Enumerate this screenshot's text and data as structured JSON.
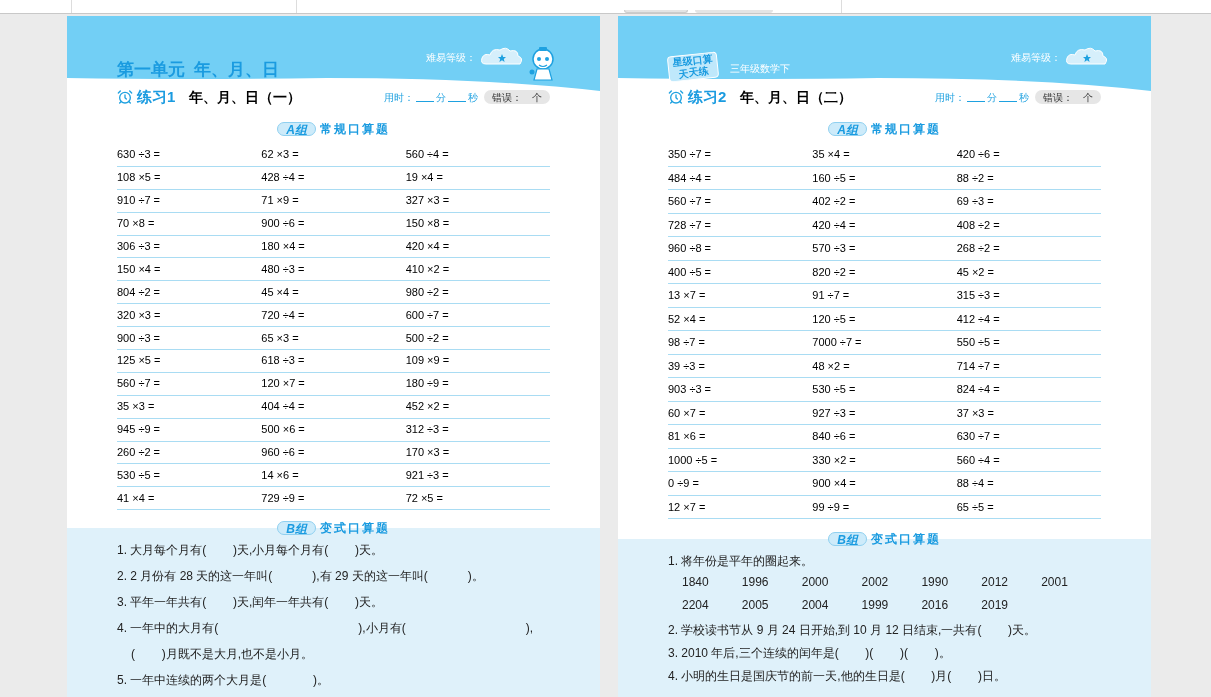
{
  "pages": [
    {
      "mascot": true,
      "unit_title": "第一单元  年、月、日",
      "difficulty_label": "难易等级：",
      "exercise_no": "练习1",
      "exercise_title": "年、月、日（一）",
      "time_label": "用时：",
      "minute_label": "分",
      "second_label": "秒",
      "error_label": "错误：",
      "error_unit": "个",
      "group_a": {
        "badge": "A组",
        "title": "常规口算题",
        "rows": [
          [
            "630 ÷3 =",
            "62 ×3 =",
            "560 ÷4 ="
          ],
          [
            "108 ×5 =",
            "428 ÷4 =",
            "19 ×4 ="
          ],
          [
            "910 ÷7 =",
            "71 ×9 =",
            "327 ×3 ="
          ],
          [
            "70 ×8 =",
            "900 ÷6 =",
            "150 ×8 ="
          ],
          [
            "306 ÷3 =",
            "180 ×4 =",
            "420 ×4 ="
          ],
          [
            "150 ×4 =",
            "480 ÷3 =",
            "410 ×2 ="
          ],
          [
            "804 ÷2 =",
            "45 ×4 =",
            "980 ÷2 ="
          ],
          [
            "320 ×3 =",
            "720 ÷4 =",
            "600 ÷7 ="
          ],
          [
            "900 ÷3 =",
            "65 ×3 =",
            "500 ÷2 ="
          ],
          [
            "125 ×5 =",
            "618 ÷3 =",
            "109 ×9 ="
          ],
          [
            "560 ÷7 =",
            "120 ×7 =",
            "180 ÷9 ="
          ],
          [
            "35 ×3 =",
            "404 ÷4 =",
            "452 ×2 ="
          ],
          [
            "945 ÷9 =",
            "500 ×6 =",
            "312 ÷3 ="
          ],
          [
            "260 ÷2 =",
            "960 ÷6 =",
            "170 ×3 ="
          ],
          [
            "530 ÷5 =",
            "14 ×6 =",
            "921 ÷3 ="
          ],
          [
            "41 ×4 =",
            "729 ÷9 =",
            "72 ×5 ="
          ]
        ]
      },
      "group_b": {
        "badge": "B组",
        "title": "变式口算题",
        "items": [
          {
            "kind": "text",
            "text": "1. 大月每个月有(        )天,小月每个月有(        )天。"
          },
          {
            "kind": "text",
            "text": "2. 2 月份有 28 天的这一年叫(            ),有 29 天的这一年叫(            )。"
          },
          {
            "kind": "text",
            "text": "3. 平年一年共有(        )天,闰年一年共有(        )天。"
          },
          {
            "kind": "text",
            "text": "4. 一年中的大月有(                                          ),小月有(                                    ),"
          },
          {
            "kind": "indent",
            "text": "(        )月既不是大月,也不是小月。"
          },
          {
            "kind": "text",
            "text": "5. 一年中连续的两个大月是(              )。"
          }
        ]
      }
    },
    {
      "mascot": false,
      "badge_lines": [
        "星级口算",
        "天天练"
      ],
      "grade": "三年级数学下",
      "difficulty_label": "难易等级：",
      "exercise_no": "练习2",
      "exercise_title": "年、月、日（二）",
      "time_label": "用时：",
      "minute_label": "分",
      "second_label": "秒",
      "error_label": "错误：",
      "error_unit": "个",
      "group_a": {
        "badge": "A组",
        "title": "常规口算题",
        "rows": [
          [
            "350 ÷7 =",
            "35 ×4 =",
            "420 ÷6 ="
          ],
          [
            "484 ÷4 =",
            "160 ÷5 =",
            "88 ÷2 ="
          ],
          [
            "560 ÷7 =",
            "402 ÷2 =",
            "69 ÷3 ="
          ],
          [
            "728 ÷7 =",
            "420 ÷4 =",
            "408 ÷2 ="
          ],
          [
            "960 ÷8 =",
            "570 ÷3 =",
            "268 ÷2 ="
          ],
          [
            "400 ÷5 =",
            "820 ÷2 =",
            "45 ×2 ="
          ],
          [
            "13 ×7 =",
            "91 ÷7 =",
            "315 ÷3 ="
          ],
          [
            "52 ×4 =",
            "120 ÷5 =",
            "412 ÷4 ="
          ],
          [
            "98 ÷7 =",
            "7000 ÷7 =",
            "550 ÷5 ="
          ],
          [
            "39 ÷3 =",
            "48 ×2 =",
            "714 ÷7 ="
          ],
          [
            "903 ÷3 =",
            "530 ÷5 =",
            "824 ÷4 ="
          ],
          [
            "60 ×7 =",
            "927 ÷3 =",
            "37 ×3 ="
          ],
          [
            "81 ×6 =",
            "840 ÷6 =",
            "630 ÷7 ="
          ],
          [
            "1000 ÷5 =",
            "330 ×2 =",
            "560 ÷4 ="
          ],
          [
            "0 ÷9 =",
            "900 ×4 =",
            "88 ÷4 ="
          ],
          [
            "12 ×7 =",
            "99 ÷9 =",
            "65 ÷5 ="
          ]
        ]
      },
      "group_b": {
        "badge": "B组",
        "title": "变式口算题",
        "items": [
          {
            "kind": "text",
            "text": "1. 将年份是平年的圈起来。"
          },
          {
            "kind": "years",
            "values": [
              "1840",
              "1996",
              "2000",
              "2002",
              "1990",
              "2012",
              "2001",
              "2204",
              "2005",
              "2004",
              "1999",
              "2016",
              "2019"
            ]
          },
          {
            "kind": "text",
            "text": "2. 学校读书节从 9 月 24 日开始,到 10 月 12 日结束,一共有(        )天。"
          },
          {
            "kind": "text",
            "text": "3. 2010 年后,三个连续的闰年是(        )(        )(        )。"
          },
          {
            "kind": "text",
            "text": "4. 小明的生日是国庆节的前一天,他的生日是(        )月(        )日。"
          }
        ]
      }
    }
  ]
}
